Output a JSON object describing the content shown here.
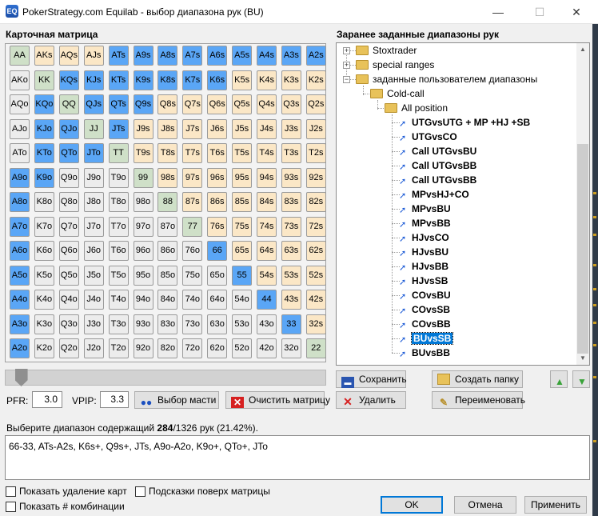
{
  "window": {
    "title": "PokerStrategy.com Equilab - выбор диапазона рук (BU)",
    "icon_label": "EQ",
    "minimize": "—",
    "maximize": "☐",
    "close": "✕"
  },
  "matrix": {
    "title": "Карточная матрица",
    "rows": [
      [
        "AA",
        "AKs",
        "AQs",
        "AJs",
        "ATs",
        "A9s",
        "A8s",
        "A7s",
        "A6s",
        "A5s",
        "A4s",
        "A3s",
        "A2s"
      ],
      [
        "AKo",
        "KK",
        "KQs",
        "KJs",
        "KTs",
        "K9s",
        "K8s",
        "K7s",
        "K6s",
        "K5s",
        "K4s",
        "K3s",
        "K2s"
      ],
      [
        "AQo",
        "KQo",
        "QQ",
        "QJs",
        "QTs",
        "Q9s",
        "Q8s",
        "Q7s",
        "Q6s",
        "Q5s",
        "Q4s",
        "Q3s",
        "Q2s"
      ],
      [
        "AJo",
        "KJo",
        "QJo",
        "JJ",
        "JTs",
        "J9s",
        "J8s",
        "J7s",
        "J6s",
        "J5s",
        "J4s",
        "J3s",
        "J2s"
      ],
      [
        "ATo",
        "KTo",
        "QTo",
        "JTo",
        "TT",
        "T9s",
        "T8s",
        "T7s",
        "T6s",
        "T5s",
        "T4s",
        "T3s",
        "T2s"
      ],
      [
        "A9o",
        "K9o",
        "Q9o",
        "J9o",
        "T9o",
        "99",
        "98s",
        "97s",
        "96s",
        "95s",
        "94s",
        "93s",
        "92s"
      ],
      [
        "A8o",
        "K8o",
        "Q8o",
        "J8o",
        "T8o",
        "98o",
        "88",
        "87s",
        "86s",
        "85s",
        "84s",
        "83s",
        "82s"
      ],
      [
        "A7o",
        "K7o",
        "Q7o",
        "J7o",
        "T7o",
        "97o",
        "87o",
        "77",
        "76s",
        "75s",
        "74s",
        "73s",
        "72s"
      ],
      [
        "A6o",
        "K6o",
        "Q6o",
        "J6o",
        "T6o",
        "96o",
        "86o",
        "76o",
        "66",
        "65s",
        "64s",
        "63s",
        "62s"
      ],
      [
        "A5o",
        "K5o",
        "Q5o",
        "J5o",
        "T5o",
        "95o",
        "85o",
        "75o",
        "65o",
        "55",
        "54s",
        "53s",
        "52s"
      ],
      [
        "A4o",
        "K4o",
        "Q4o",
        "J4o",
        "T4o",
        "94o",
        "84o",
        "74o",
        "64o",
        "54o",
        "44",
        "43s",
        "42s"
      ],
      [
        "A3o",
        "K3o",
        "Q3o",
        "J3o",
        "T3o",
        "93o",
        "83o",
        "73o",
        "63o",
        "53o",
        "43o",
        "33",
        "32s"
      ],
      [
        "A2o",
        "K2o",
        "Q2o",
        "J2o",
        "T2o",
        "92o",
        "82o",
        "72o",
        "62o",
        "52o",
        "42o",
        "32o",
        "22"
      ]
    ],
    "selected": [
      "ATs",
      "A9s",
      "A8s",
      "A7s",
      "A6s",
      "A5s",
      "A4s",
      "A3s",
      "A2s",
      "KQs",
      "KJs",
      "KTs",
      "K9s",
      "K8s",
      "K7s",
      "K6s",
      "KQo",
      "QJs",
      "QTs",
      "Q9s",
      "KJo",
      "QJo",
      "JTs",
      "KTo",
      "QTo",
      "JTo",
      "A9o",
      "K9o",
      "A8o",
      "A7o",
      "A6o",
      "66",
      "A5o",
      "55",
      "A4o",
      "44",
      "A3o",
      "33",
      "A2o"
    ],
    "colors": {
      "suited": "#fbe7c6",
      "offsuit": "#ececec",
      "pair": "#cfe0c8",
      "selected": "#5aa6f6"
    }
  },
  "controls": {
    "pfr_label": "PFR:",
    "pfr_value": "3.0",
    "vpip_label": "VPIP:",
    "vpip_value": "3.3",
    "select_suits": "Выбор масти",
    "clear_matrix": "Очистить матрицу",
    "slider_value": 0.03
  },
  "tree": {
    "title": "Заранее заданные диапазоны рук",
    "root_items": [
      {
        "label": "Stoxtrader",
        "expander": "+"
      },
      {
        "label": "special ranges",
        "expander": "+"
      },
      {
        "label": "заданные пользователем диапазоны",
        "expander": "−"
      }
    ],
    "folder1": "Cold-call",
    "folder2": "All position",
    "leaves": [
      "UTGvsUTG + MP +HJ +SB",
      "UTGvsCO",
      "Call UTGvsBU",
      "Call UTGvsBB",
      "Call UTGvsBB",
      "MPvsHJ+CO",
      "MPvsBU",
      "MPvsBB",
      "HJvsCO",
      "HJvsBU",
      "HJvsBB",
      "HJvsSB",
      "COvsBU",
      "COvsSB",
      "COvsBB",
      "BUvsSB",
      "BUvsBB"
    ],
    "selected_leaf": "BUvsSB",
    "scroll_up": "▲",
    "scroll_down": "▼"
  },
  "tree_buttons": {
    "save": "Сохранить",
    "create_folder": "Создать папку",
    "delete": "Удалить",
    "rename": "Переименовать"
  },
  "info": {
    "prefix": "Выберите диапазон содержащий ",
    "count": "284",
    "suffix": "/1326 рук (21.42%)."
  },
  "range_text": "66-33, ATs-A2s, K6s+, Q9s+, JTs, A9o-A2o, K9o+, QTo+, JTo",
  "checkboxes": {
    "show_removal": "Показать удаление карт",
    "hints": "Подсказки поверх матрицы",
    "show_combos": "Показать # комбинации"
  },
  "footer": {
    "ok": "OK",
    "cancel": "Отмена",
    "apply": "Применить"
  }
}
